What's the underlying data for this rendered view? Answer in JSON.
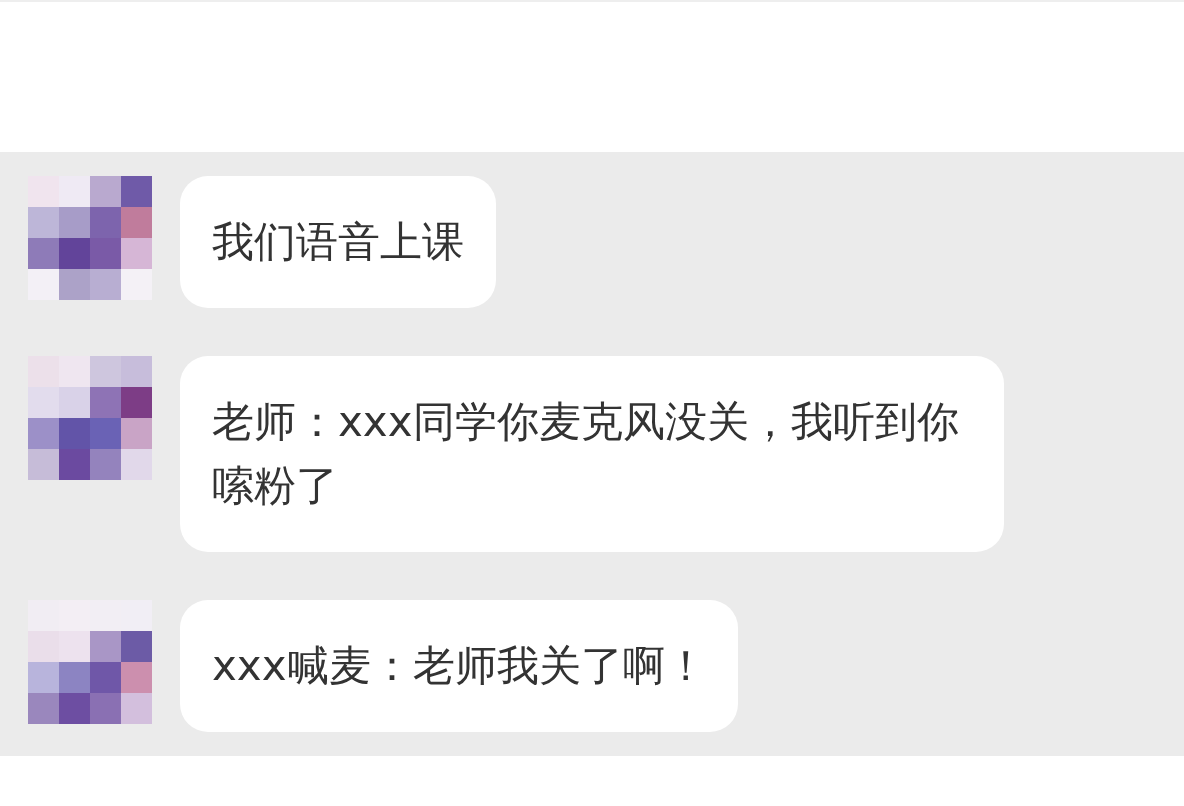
{
  "messages": [
    {
      "text": "我们语音上课"
    },
    {
      "text": "老师：xxx同学你麦克风没关，我听到你嗦粉了"
    },
    {
      "text": "xxx喊麦：老师我关了啊！"
    }
  ]
}
